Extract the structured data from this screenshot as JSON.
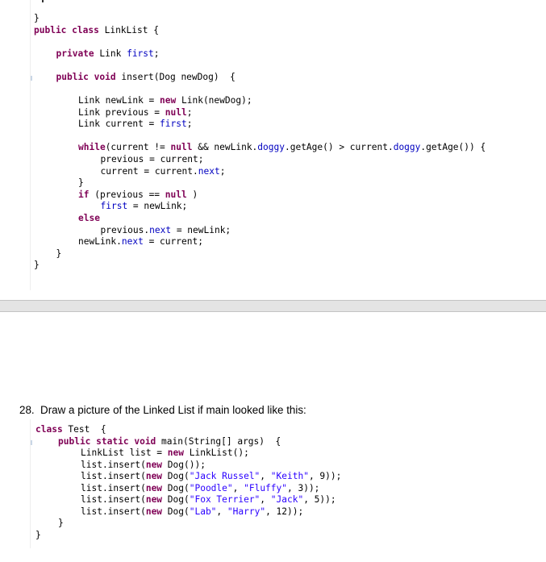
{
  "top_code": {
    "lines": [
      {
        "indent": 0,
        "tokens": [
          {
            "t": "}",
            "c": ""
          }
        ]
      },
      {
        "indent": 0,
        "tokens": [
          {
            "t": "public",
            "c": "kw"
          },
          {
            "t": " ",
            "c": ""
          },
          {
            "t": "class",
            "c": "kw"
          },
          {
            "t": " LinkList {",
            "c": ""
          }
        ]
      },
      {
        "indent": 1,
        "tokens": [
          {
            "t": "private",
            "c": "kw"
          },
          {
            "t": " Link ",
            "c": ""
          },
          {
            "t": "first",
            "c": "fld"
          },
          {
            "t": ";",
            "c": ""
          }
        ]
      },
      {
        "indent": 1,
        "tokens": [
          {
            "t": "public",
            "c": "kw"
          },
          {
            "t": " ",
            "c": ""
          },
          {
            "t": "void",
            "c": "kw"
          },
          {
            "t": " insert(Dog newDog)  {",
            "c": ""
          }
        ]
      },
      {
        "indent": 2,
        "tokens": [
          {
            "t": "Link newLink = ",
            "c": ""
          },
          {
            "t": "new",
            "c": "kw"
          },
          {
            "t": " Link(newDog);",
            "c": ""
          }
        ]
      },
      {
        "indent": 2,
        "tokens": [
          {
            "t": "Link previous = ",
            "c": ""
          },
          {
            "t": "null",
            "c": "kw"
          },
          {
            "t": ";",
            "c": ""
          }
        ]
      },
      {
        "indent": 2,
        "tokens": [
          {
            "t": "Link current = ",
            "c": ""
          },
          {
            "t": "first",
            "c": "fld"
          },
          {
            "t": ";",
            "c": ""
          }
        ]
      },
      {
        "indent": 2,
        "tokens": [
          {
            "t": "while",
            "c": "kw"
          },
          {
            "t": "(current != ",
            "c": ""
          },
          {
            "t": "null",
            "c": "kw"
          },
          {
            "t": " && newLink.",
            "c": ""
          },
          {
            "t": "doggy",
            "c": "fld"
          },
          {
            "t": ".getAge() > current.",
            "c": ""
          },
          {
            "t": "doggy",
            "c": "fld"
          },
          {
            "t": ".getAge()) {",
            "c": ""
          }
        ]
      },
      {
        "indent": 3,
        "tokens": [
          {
            "t": "previous = current;",
            "c": ""
          }
        ]
      },
      {
        "indent": 3,
        "tokens": [
          {
            "t": "current = current.",
            "c": ""
          },
          {
            "t": "next",
            "c": "fld"
          },
          {
            "t": ";",
            "c": ""
          }
        ]
      },
      {
        "indent": 2,
        "tokens": [
          {
            "t": "}",
            "c": ""
          }
        ]
      },
      {
        "indent": 2,
        "tokens": [
          {
            "t": "if",
            "c": "kw"
          },
          {
            "t": " (previous == ",
            "c": ""
          },
          {
            "t": "null",
            "c": "kw"
          },
          {
            "t": " )",
            "c": ""
          }
        ]
      },
      {
        "indent": 3,
        "tokens": [
          {
            "t": "first",
            "c": "fld"
          },
          {
            "t": " = newLink;",
            "c": ""
          }
        ]
      },
      {
        "indent": 2,
        "tokens": [
          {
            "t": "else",
            "c": "kw"
          }
        ]
      },
      {
        "indent": 3,
        "tokens": [
          {
            "t": "previous.",
            "c": ""
          },
          {
            "t": "next",
            "c": "fld"
          },
          {
            "t": " = newLink;",
            "c": ""
          }
        ]
      },
      {
        "indent": 2,
        "tokens": [
          {
            "t": "newLink.",
            "c": ""
          },
          {
            "t": "next",
            "c": "fld"
          },
          {
            "t": " = current;",
            "c": ""
          }
        ]
      },
      {
        "indent": 1,
        "tokens": [
          {
            "t": "}",
            "c": ""
          }
        ]
      },
      {
        "indent": 0,
        "tokens": [
          {
            "t": "}",
            "c": ""
          }
        ]
      }
    ]
  },
  "question": {
    "text": "28.  Draw a picture of the Linked List if main looked like this:"
  },
  "bottom_code": {
    "lines": [
      {
        "indent": 0,
        "tokens": [
          {
            "t": "class",
            "c": "kw"
          },
          {
            "t": " Test  {",
            "c": ""
          }
        ]
      },
      {
        "indent": 1,
        "tokens": [
          {
            "t": "public",
            "c": "kw"
          },
          {
            "t": " ",
            "c": ""
          },
          {
            "t": "static",
            "c": "kw"
          },
          {
            "t": " ",
            "c": ""
          },
          {
            "t": "void",
            "c": "kw"
          },
          {
            "t": " main(String[] args)  {",
            "c": ""
          }
        ]
      },
      {
        "indent": 2,
        "tokens": [
          {
            "t": "LinkList list = ",
            "c": ""
          },
          {
            "t": "new",
            "c": "kw"
          },
          {
            "t": " LinkList();",
            "c": ""
          }
        ]
      },
      {
        "indent": 2,
        "tokens": [
          {
            "t": "list.insert(",
            "c": ""
          },
          {
            "t": "new",
            "c": "kw"
          },
          {
            "t": " Dog());",
            "c": ""
          }
        ]
      },
      {
        "indent": 2,
        "tokens": [
          {
            "t": "list.insert(",
            "c": ""
          },
          {
            "t": "new",
            "c": "kw"
          },
          {
            "t": " Dog(",
            "c": ""
          },
          {
            "t": "\"Jack Russel\"",
            "c": "str"
          },
          {
            "t": ", ",
            "c": ""
          },
          {
            "t": "\"Keith\"",
            "c": "str"
          },
          {
            "t": ", 9));",
            "c": ""
          }
        ]
      },
      {
        "indent": 2,
        "tokens": [
          {
            "t": "list.insert(",
            "c": ""
          },
          {
            "t": "new",
            "c": "kw"
          },
          {
            "t": " Dog(",
            "c": ""
          },
          {
            "t": "\"Poodle\"",
            "c": "str"
          },
          {
            "t": ", ",
            "c": ""
          },
          {
            "t": "\"Fluffy\"",
            "c": "str"
          },
          {
            "t": ", 3));",
            "c": ""
          }
        ]
      },
      {
        "indent": 2,
        "tokens": [
          {
            "t": "list.insert(",
            "c": ""
          },
          {
            "t": "new",
            "c": "kw"
          },
          {
            "t": " Dog(",
            "c": ""
          },
          {
            "t": "\"Fox Terrier\"",
            "c": "str"
          },
          {
            "t": ", ",
            "c": ""
          },
          {
            "t": "\"Jack\"",
            "c": "str"
          },
          {
            "t": ", 5));",
            "c": ""
          }
        ]
      },
      {
        "indent": 2,
        "tokens": [
          {
            "t": "list.insert(",
            "c": ""
          },
          {
            "t": "new",
            "c": "kw"
          },
          {
            "t": " Dog(",
            "c": ""
          },
          {
            "t": "\"Lab\"",
            "c": "str"
          },
          {
            "t": ", ",
            "c": ""
          },
          {
            "t": "\"Harry\"",
            "c": "str"
          },
          {
            "t": ", 12));",
            "c": ""
          }
        ]
      },
      {
        "indent": 1,
        "tokens": [
          {
            "t": "}",
            "c": ""
          }
        ]
      },
      {
        "indent": 0,
        "tokens": [
          {
            "t": "}",
            "c": ""
          }
        ]
      }
    ]
  }
}
